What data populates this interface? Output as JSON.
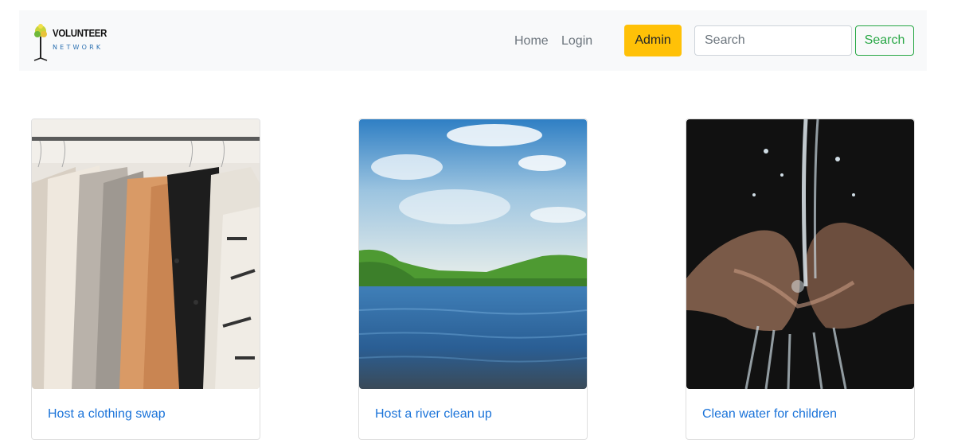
{
  "logo": {
    "title": "VOLUNTEER",
    "subtitle": "NETWORK"
  },
  "nav": {
    "home_label": "Home",
    "login_label": "Login",
    "admin_label": "Admin",
    "search_placeholder": "Search",
    "search_button_label": "Search"
  },
  "colors": {
    "navbar_bg": "#f8f9fa",
    "admin_button": "#ffc107",
    "search_button": "#28a745",
    "card_link": "#1a73d9"
  },
  "cards": [
    {
      "title": "Host a clothing swap",
      "image": "clothes-rack-photo"
    },
    {
      "title": "Host a river clean up",
      "image": "river-landscape-photo"
    },
    {
      "title": "Clean water for children",
      "image": "water-hands-photo"
    }
  ]
}
